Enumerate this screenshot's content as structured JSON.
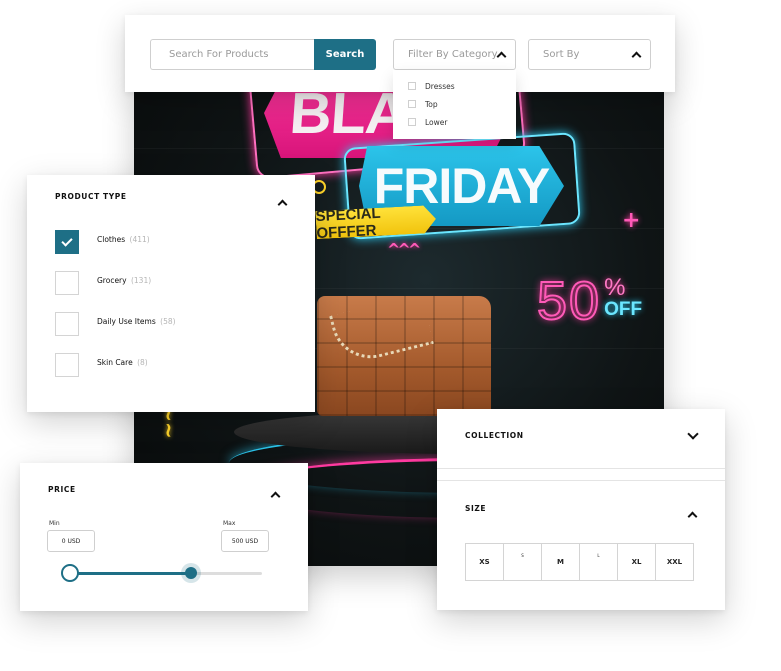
{
  "colors": {
    "accent": "#1e6f86",
    "border": "#cfcfcf",
    "neon_pink": "#ff3aa0",
    "neon_blue": "#2cc4ea",
    "neon_yellow": "#ffd42a"
  },
  "topbar": {
    "search_placeholder": "Search For Products",
    "search_button": "Search",
    "category_select": {
      "label": "Filter By Category",
      "icon": "chevron-up-icon",
      "expanded": true,
      "options": [
        {
          "label": "Dresses",
          "checked": false
        },
        {
          "label": "Top",
          "checked": false
        },
        {
          "label": "Lower",
          "checked": false
        }
      ]
    },
    "sort_select": {
      "label": "Sort By",
      "icon": "chevron-up-icon"
    }
  },
  "banner": {
    "line1": "BLACK",
    "line2": "FRIDAY",
    "tag": "SPECIAL OFFFER",
    "discount_number": "50",
    "discount_percent": "%",
    "discount_off": "OFF",
    "decor": {
      "zigzag": "^^^",
      "plus": "+",
      "yellow_zigzag": "~~"
    }
  },
  "product_type": {
    "title": "PRODUCT TYPE",
    "icon": "chevron-up-icon",
    "items": [
      {
        "label": "Clothes",
        "count": "(411)",
        "checked": true
      },
      {
        "label": "Grocery",
        "count": "(131)",
        "checked": false
      },
      {
        "label": "Daily Use Items",
        "count": "(58)",
        "checked": false
      },
      {
        "label": "Skin Care",
        "count": "(8)",
        "checked": false
      }
    ]
  },
  "price": {
    "title": "PRICE",
    "icon": "chevron-up-icon",
    "min_label": "Min",
    "max_label": "Max",
    "min_value": "0 USD",
    "max_value": "500 USD",
    "slider": {
      "min_fraction": 0.0,
      "max_fraction": 0.63
    }
  },
  "collection": {
    "title": "COLLECTION",
    "icon": "chevron-down-icon",
    "expanded": false
  },
  "size": {
    "title": "SIZE",
    "icon": "chevron-up-icon",
    "options": [
      {
        "label": "XS",
        "tiny": false
      },
      {
        "label": "S",
        "tiny": true
      },
      {
        "label": "M",
        "tiny": false
      },
      {
        "label": "L",
        "tiny": true
      },
      {
        "label": "XL",
        "tiny": false
      },
      {
        "label": "XXL",
        "tiny": false
      }
    ]
  }
}
